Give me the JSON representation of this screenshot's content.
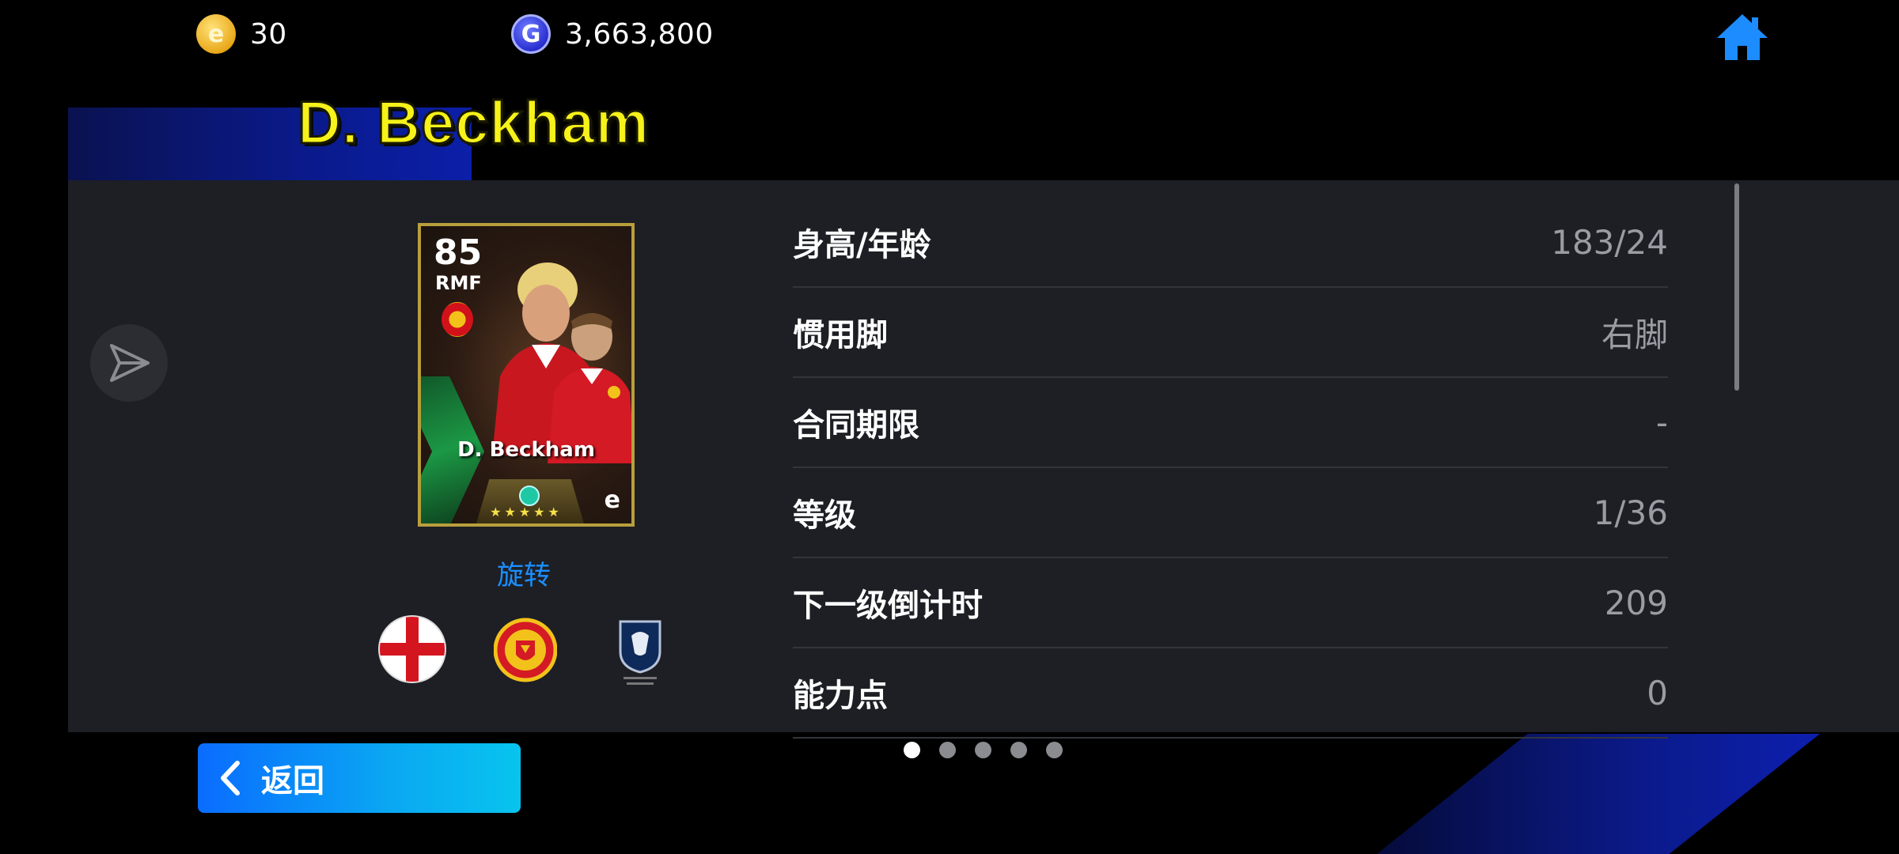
{
  "header": {
    "coins": {
      "icon": "efootball-coin-icon",
      "value": "30"
    },
    "gp": {
      "icon": "gp-coin-icon",
      "value": "3,663,800"
    },
    "home_icon": "home-icon"
  },
  "player": {
    "name": "D. Beckham",
    "card": {
      "rating": "85",
      "position": "RMF",
      "name": "D. Beckham",
      "stars": "★★★★★"
    },
    "rotate_label": "旋转",
    "badges": [
      "england-flag-icon",
      "manchester-united-crest-icon",
      "english-league-icon"
    ]
  },
  "stats": [
    {
      "label": "身高/年龄",
      "value": "183/24"
    },
    {
      "label": "惯用脚",
      "value": "右脚"
    },
    {
      "label": "合同期限",
      "value": "-"
    },
    {
      "label": "等级",
      "value": "1/36"
    },
    {
      "label": "下一级倒计时",
      "value": "209"
    },
    {
      "label": "能力点",
      "value": "0"
    }
  ],
  "pagination": {
    "total": 5,
    "current": 1
  },
  "footer": {
    "back_label": "返回"
  },
  "colors": {
    "name_yellow": "#f6f21a",
    "link_blue": "#1b8fff",
    "back_button": "#0a8cf5"
  }
}
